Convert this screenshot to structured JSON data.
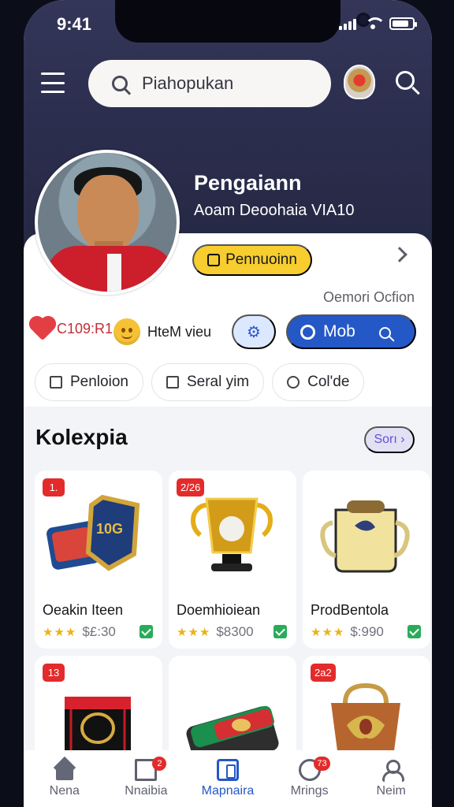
{
  "status": {
    "time": "9:41"
  },
  "header": {
    "search_placeholder": "Piahopukan",
    "profile_name": "Pengaiann",
    "profile_subtitle": "Aoam Deoohaia VIA10"
  },
  "profile": {
    "cta_label": "Pennuoinn",
    "security_note": "Oemori Ocfion",
    "stat_value": "C109:R1",
    "stat_label": "HteM vieu",
    "mode_label": "Mob"
  },
  "chips": [
    "Penloion",
    "Seral yim",
    "Col'de"
  ],
  "section": {
    "title": "Kolexpia",
    "see_all": "Sorı"
  },
  "cards": [
    {
      "badge": "1.",
      "title": "Oeakin Iteen",
      "stars": "★★★",
      "price": "$£:30"
    },
    {
      "badge": "2/26",
      "title": "Doemhioiean",
      "stars": "★★★",
      "price": "$8300"
    },
    {
      "badge": "",
      "title": "ProdBentola",
      "stars": "★★★",
      "price": "$:990"
    },
    {
      "badge": "13",
      "title": "",
      "stars": "",
      "price": ""
    },
    {
      "badge": "",
      "title": "",
      "stars": "",
      "price": ""
    },
    {
      "badge": "2a2",
      "title": "",
      "stars": "",
      "price": ""
    }
  ],
  "bottom_nav": [
    {
      "label": "Nena",
      "badge": ""
    },
    {
      "label": "Nnaibia",
      "badge": "2"
    },
    {
      "label": "Mapnaira",
      "badge": ""
    },
    {
      "label": "Mrings",
      "badge": "73"
    },
    {
      "label": "Neim",
      "badge": ""
    }
  ]
}
